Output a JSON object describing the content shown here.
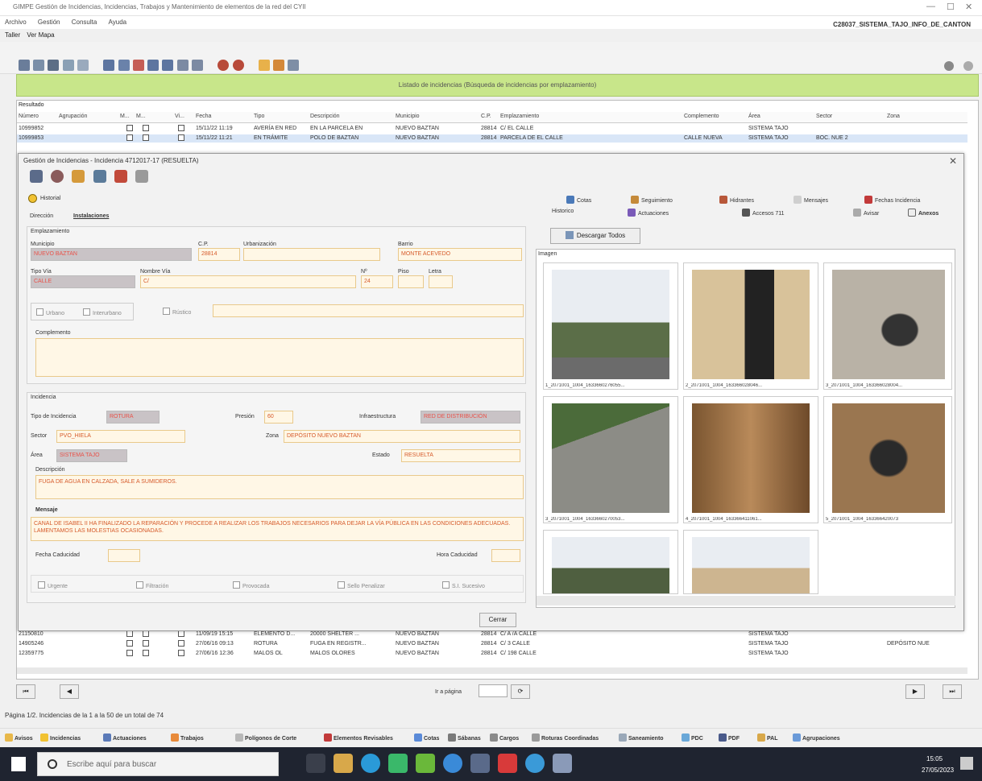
{
  "window": {
    "title": "GIMPE Gestión de Incidencias, Incidencias, Trabajos y Mantenimiento de elementos de la red del CYII",
    "min": "—",
    "max": "☐",
    "close": "✕"
  },
  "menu": {
    "items": [
      "Archivo",
      "Gestión",
      "Consulta",
      "Ayuda"
    ],
    "user": "C28037_SISTEMA_TAJO_INFO_DE_CANTON"
  },
  "tabs": {
    "t1": "Taller",
    "t2": "Ver Mapa"
  },
  "green_banner": "Listado de incidencias (Búsqueda de incidencias por emplazamiento)",
  "list": {
    "label": "Resultado",
    "headers": [
      "Número",
      "Agrupación",
      "M...",
      "M...",
      "Vi...",
      "Fecha",
      "Tipo",
      "Descripción",
      "Municipio",
      "C.P.",
      "Emplazamiento",
      "Complemento",
      "Área",
      "Sector",
      "Zona"
    ],
    "rows_top": [
      [
        "10999852",
        "",
        "",
        "",
        "",
        "15/11/22 11:19",
        "AVERÍA EN RED",
        "EN LA PARCELA EN",
        "NUEVO BAZTAN",
        "28814",
        "C/ EL CALLE",
        "",
        "SISTEMA TAJO",
        "",
        ""
      ],
      [
        "10999853",
        "",
        "",
        "",
        "",
        "15/11/22 11:21",
        "EN TRÁMITE",
        "POLO DE BAZTAN",
        "NUEVO BAZTAN",
        "28814",
        "PARCELA DE EL CALLE",
        "CALLE NUEVA",
        "SISTEMA TAJO",
        "BOC. NUE 2",
        ""
      ]
    ],
    "rows_bottom": [
      [
        "21150810",
        "",
        "",
        "",
        "",
        "11/09/19 15:15",
        "ELEMENTO D...",
        "20000 SHELTER ...",
        "NUEVO BAZTAN",
        "28814",
        "C/ A /A CALLE",
        "",
        "SISTEMA TAJO",
        "",
        ""
      ],
      [
        "14905246",
        "",
        "",
        "",
        "",
        "27/06/16 09:13",
        "ROTURA",
        "FUGA EN REGISTR...",
        "NUEVO BAZTAN",
        "28814",
        "C/ 3 CALLE",
        "",
        "SISTEMA TAJO",
        "",
        "DEPÓSITO NUE"
      ],
      [
        "12359775",
        "",
        "",
        "",
        "",
        "27/06/16 12:36",
        "MALOS OL",
        "MALOS OLORES",
        "NUEVO BAZTAN",
        "28814",
        "C/ 198 CALLE",
        "",
        "SISTEMA TAJO",
        "",
        ""
      ]
    ]
  },
  "dialog": {
    "title": "Gestión de Incidencias - Incidencia 4712017-17 (RESUELTA)",
    "historial": "Historial",
    "direccion_label": "Dirección",
    "direccion_tab": "Instalaciones",
    "emplazamiento": {
      "section": "Emplazamiento",
      "municipio_label": "Municipio",
      "municipio": "NUEVO BAZTAN",
      "cp_label": "C.P.",
      "cp": "28814",
      "urbanizacion_label": "Urbanización",
      "urbanizacion": "",
      "barrio_label": "Barrio",
      "barrio": "MONTE ACEVEDO",
      "tipovia_label": "Tipo Vía",
      "tipovia": "CALLE",
      "nombrevia_label": "Nombre Vía",
      "nombrevia": "C/",
      "num_label": "Nº",
      "num": "24",
      "piso_label": "Piso",
      "piso": "",
      "letra_label": "Letra",
      "letra": "",
      "urbano": "Urbano",
      "interurbano": "Interurbano",
      "rustico": "Rústico",
      "complemento_label": "Complemento"
    },
    "incidencia": {
      "section": "Incidencia",
      "tipo_label": "Tipo de Incidencia",
      "tipo": "ROTURA",
      "presion_label": "Presión",
      "presion": "60",
      "infra_label": "Infraestructura",
      "infra": "RED DE DISTRIBUCIÓN",
      "sector_label": "Sector",
      "sector": "PVO_HIELA",
      "zona_label": "Zona",
      "zona": "DEPÓSITO NUEVO BAZTAN",
      "area_label": "Área",
      "area": "SISTEMA TAJO",
      "estado_label": "Estado",
      "estado": "RESUELTA",
      "desc_label": "Descripción",
      "desc": "FUGA DE AGUA EN CALZADA, SALE A SUMIDEROS.",
      "msg_label": "Mensaje",
      "msg": "CANAL DE ISABEL II HA FINALIZADO LA REPARACIÓN Y PROCEDE A REALIZAR LOS TRABAJOS NECESARIOS PARA DEJAR LA VÍA PÚBLICA EN LAS CONDICIONES ADECUADAS. LAMENTAMOS LAS MOLESTIAS OCASIONADAS.",
      "fecha_label": "Fecha Caducidad",
      "hora_label": "Hora Caducidad",
      "flags": [
        "Urgente",
        "Filtración",
        "Provocada",
        "Sello Penalizar",
        "S.I. Sucesivo"
      ]
    },
    "right_tabs": [
      "Cotas",
      "Seguimiento",
      "Hidrantes",
      "Mensajes",
      "Fechas Incidencia",
      "Historico",
      "Actuaciones",
      "Accesos 711",
      "Avisar",
      "Anexos"
    ],
    "download": "Descargar Todos",
    "images_label": "Imagen",
    "captions": [
      "1_2071001_1004_1633660276055...",
      "2_2071001_1004_163366028046...",
      "3_2071001_1004_163366028004...",
      "3_2071001_1004_1633660270053...",
      "4_2071001_1004_163366411061...",
      "5_2071001_1004_163366420073"
    ],
    "cerrar": "Cerrar"
  },
  "pager": {
    "goto": "Ir a página",
    "ok": "⟳"
  },
  "status": "Página 1/2. Incidencias de la 1 a la 50 de un total de 74",
  "bottom": [
    "Avisos",
    "Incidencias",
    "Actuaciones",
    "Trabajos",
    "Polígonos de Corte",
    "Elementos Revisables",
    "Cotas",
    "Sábanas",
    "Cargos",
    "Roturas Coordinadas",
    "Saneamiento",
    "PDC",
    "PDF",
    "PAL",
    "Agrupaciones"
  ],
  "taskbar": {
    "search": "Escribe aquí para buscar",
    "time": "15:05",
    "date": "27/05/2023"
  }
}
